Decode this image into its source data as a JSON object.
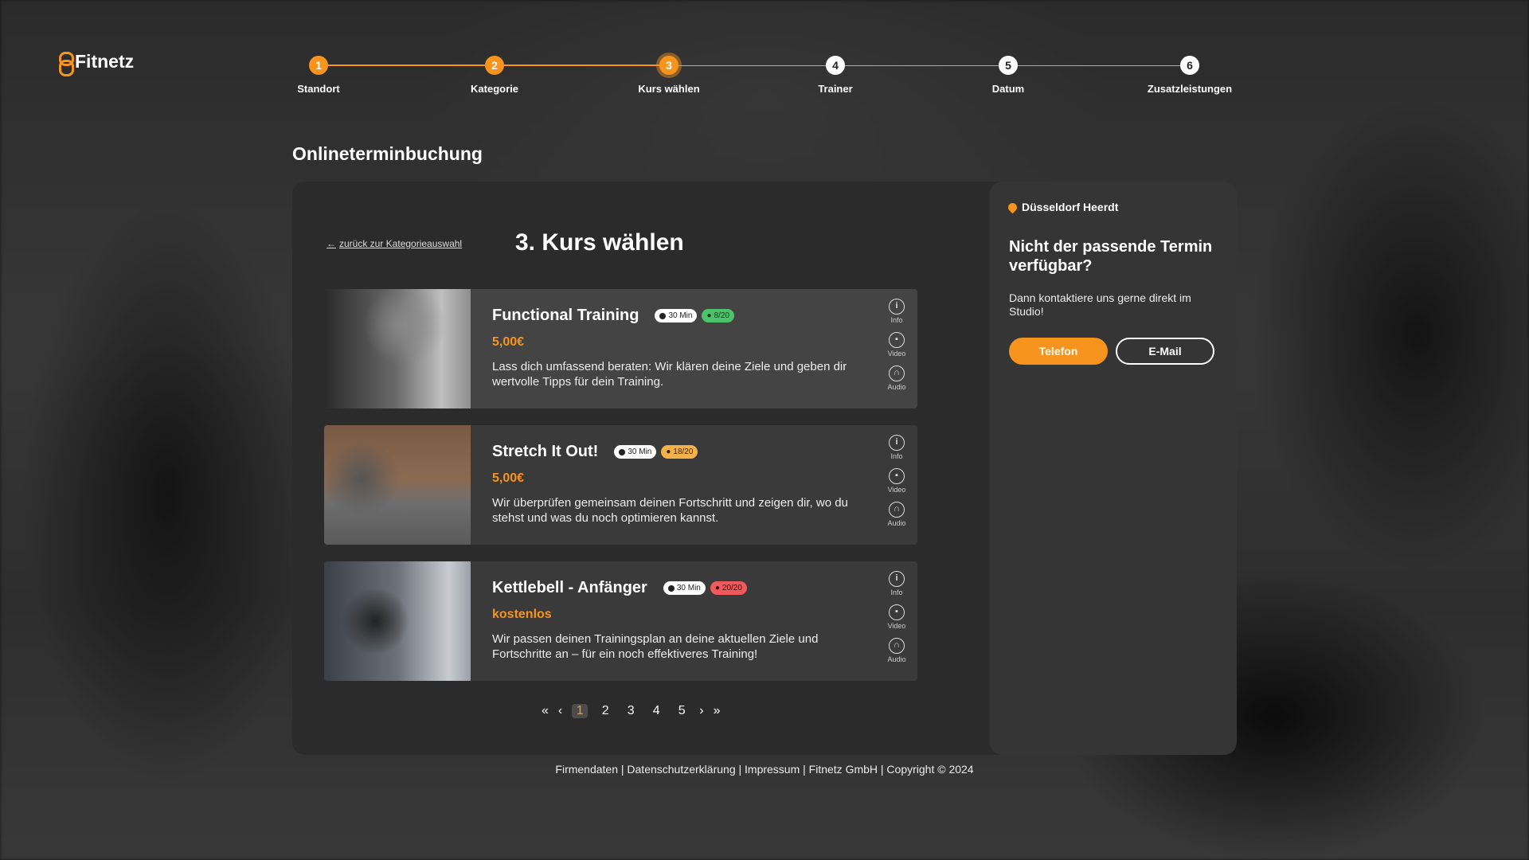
{
  "brand": {
    "name": "Fitnetz",
    "accent": "#f7941d"
  },
  "stepper": [
    {
      "num": "1",
      "label": "Standort",
      "state": "done"
    },
    {
      "num": "2",
      "label": "Kategorie",
      "state": "done"
    },
    {
      "num": "3",
      "label": "Kurs wählen",
      "state": "active"
    },
    {
      "num": "4",
      "label": "Trainer",
      "state": "todo"
    },
    {
      "num": "5",
      "label": "Datum",
      "state": "todo"
    },
    {
      "num": "6",
      "label": "Zusatzleistungen",
      "state": "todo"
    }
  ],
  "page_title": "Onlineterminbuchung",
  "main": {
    "back_link": "zurück zur Kategorieauswahl",
    "title": "3. Kurs wählen",
    "courses": [
      {
        "title": "Functional Training",
        "duration": "30 Min",
        "slots": "8/20",
        "slots_status": "green",
        "price": "5,00€",
        "description": "Lass dich umfassend beraten: Wir klären deine Ziele und geben dir wertvolle Tipps für dein Training.",
        "actions": [
          "Info",
          "Video",
          "Audio"
        ]
      },
      {
        "title": "Stretch It Out!",
        "duration": "30 Min",
        "slots": "18/20",
        "slots_status": "yellow",
        "price": "5,00€",
        "description": "Wir überprüfen gemeinsam deinen Fortschritt und zeigen dir, wo du stehst und was du noch optimieren kannst.",
        "actions": [
          "Info",
          "Video",
          "Audio"
        ]
      },
      {
        "title": "Kettlebell - Anfänger",
        "duration": "30 Min",
        "slots": "20/20",
        "slots_status": "red",
        "price": "kostenlos",
        "description": "Wir passen deinen Trainingsplan an deine aktuellen Ziele und Fortschritte an – für ein noch effektiveres Training!",
        "actions": [
          "Info",
          "Video",
          "Audio"
        ]
      }
    ],
    "pagination": {
      "pages": [
        "1",
        "2",
        "3",
        "4",
        "5"
      ],
      "current": "1"
    }
  },
  "side": {
    "location": "Düsseldorf Heerdt",
    "heading": "Nicht der passende Termin verfügbar?",
    "text": "Dann kontaktiere uns gerne direkt im Studio!",
    "phone_label": "Telefon",
    "mail_label": "E-Mail"
  },
  "footer": "Firmendaten | Datenschutzerklärung | Impressum | Fitnetz GmbH | Copyright © 2024"
}
